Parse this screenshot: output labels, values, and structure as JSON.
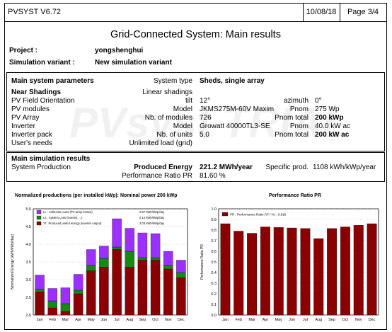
{
  "header": {
    "software": "PVSYST V6.72",
    "date": "10/08/18",
    "page": "Page 3/4"
  },
  "title": "Grid-Connected System: Main results",
  "project": {
    "label": "Project :",
    "value": "yongshenghui"
  },
  "variant": {
    "label": "Simulation variant :",
    "value": "New simulation variant"
  },
  "params": {
    "heading": "Main system parameters",
    "system_type_label": "System type",
    "system_type_value": "Sheds, single array",
    "near_shadings_label": "Near Shadings",
    "near_shadings_value": "Linear shadings",
    "pv_field_label": "PV Field Orientation",
    "tilt_label": "tilt",
    "tilt_value": "12°",
    "azimuth_label": "azimuth",
    "azimuth_value": "0°",
    "pv_modules_label": "PV modules",
    "model_label": "Model",
    "module_model": "JKMS275M-60V Maxim",
    "pnom_label": "Pnom",
    "module_pnom": "275 Wp",
    "pv_array_label": "PV Array",
    "nb_modules_label": "Nb. of modules",
    "nb_modules": "726",
    "pnom_total_label": "Pnom total",
    "array_pnom_total": "200 kWp",
    "inverter_label": "Inverter",
    "inverter_model": "Growatt 40000TL3-SE",
    "inverter_pnom": "40.0 kW ac",
    "inverter_pack_label": "Inverter pack",
    "nb_units_label": "Nb. of units",
    "nb_units": "5.0",
    "inverter_pnom_total": "200 kW ac",
    "users_needs_label": "User's needs",
    "users_needs_value": "Unlimited load (grid)"
  },
  "results": {
    "heading": "Main simulation results",
    "system_production_label": "System Production",
    "produced_energy_label": "Produced Energy",
    "produced_energy_value": "221.2 MWh/year",
    "specific_prod_label": "Specific prod.",
    "specific_prod_value": "1108 kWh/kWp/year",
    "pr_label": "Performance Ratio PR",
    "pr_value": "81.60 %"
  },
  "watermarks": {
    "top": "PVsyst TRIAL",
    "chart": "PVsyst"
  },
  "colors": {
    "lc": "#9b30ff",
    "ls": "#138a13",
    "yf": "#8b0000"
  },
  "chart_data": [
    {
      "type": "bar",
      "title": "Normalized productions (per installed kWp):  Nominal power 200 kWp",
      "ylabel": "Normalized Energy [kWh/kWp/day]",
      "ylim": [
        2.0,
        5.0
      ],
      "yticks": [
        "2.0",
        "2.5",
        "3.0",
        "3.5",
        "4.0",
        "4.5",
        "5.0"
      ],
      "categories": [
        "Jan",
        "Feb",
        "Mar",
        "Apr",
        "May",
        "Jun",
        "Jul",
        "Aug",
        "Sep",
        "Oct",
        "Nov",
        "Dec"
      ],
      "series": [
        {
          "name": "Yf : Produced useful energy  (inverter output)",
          "legend_value": "3.03 kWh/kWp/day",
          "values": [
            2.65,
            2.2,
            2.1,
            2.6,
            3.25,
            3.35,
            3.85,
            3.35,
            3.55,
            3.55,
            3.3,
            3.05
          ]
        },
        {
          "name": "Ls : System Loss  (inverter, ...)",
          "legend_value": "0.12 kWh/kWp/day",
          "values": [
            0.08,
            0.2,
            0.22,
            0.1,
            0.15,
            0.25,
            0.07,
            0.45,
            0.07,
            0.07,
            0.1,
            0.15
          ]
        },
        {
          "name": "Lc : Collection Loss (PV-array losses)",
          "legend_value": "0.57 kWh/kWp/day",
          "values": [
            0.4,
            0.35,
            0.45,
            0.45,
            0.45,
            0.35,
            0.8,
            0.65,
            0.7,
            0.68,
            0.4,
            0.35
          ]
        }
      ]
    },
    {
      "type": "bar",
      "title": "Performance Ratio PR",
      "ylabel": "Performance Ratio PR",
      "ylim": [
        0.0,
        1.0
      ],
      "yticks": [
        "0.0",
        "0.1",
        "0.2",
        "0.3",
        "0.4",
        "0.5",
        "0.6",
        "0.7",
        "0.8",
        "0.9",
        "1.0"
      ],
      "categories": [
        "Jan",
        "Feb",
        "Mar",
        "Apr",
        "May",
        "Jun",
        "Jul",
        "Aug",
        "Sep",
        "Oct",
        "Nov",
        "Dec"
      ],
      "series": [
        {
          "name": "PR : Performance Ratio (Yf / Yr) :  0.816",
          "values": [
            0.86,
            0.79,
            0.77,
            0.83,
            0.825,
            0.82,
            0.815,
            0.72,
            0.815,
            0.83,
            0.845,
            0.86
          ]
        }
      ]
    }
  ]
}
